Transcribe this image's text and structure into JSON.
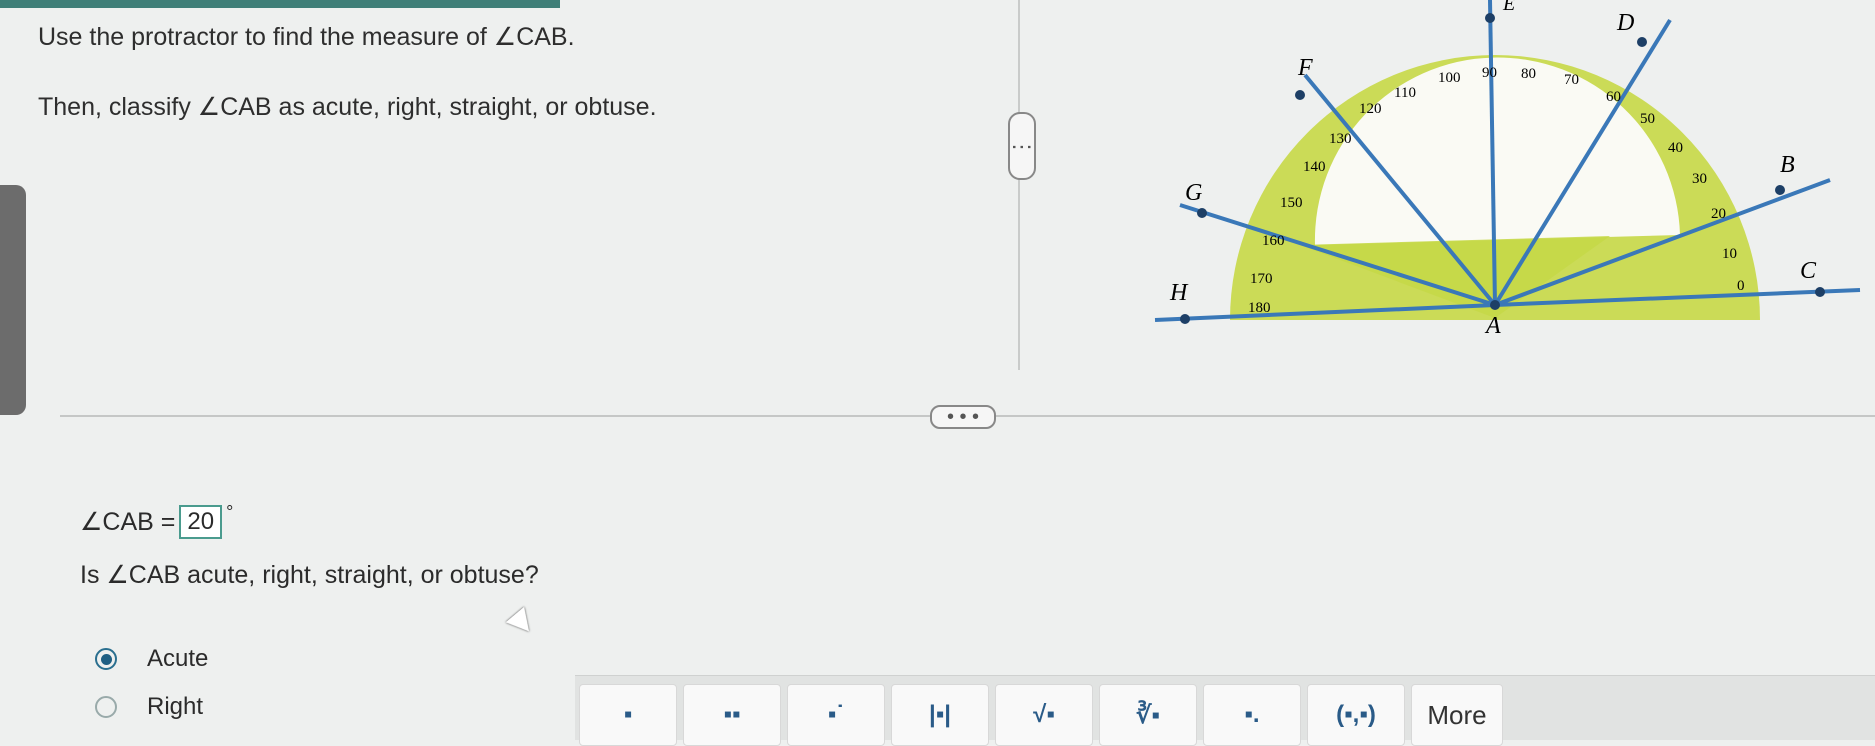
{
  "instructions": {
    "line1": "Use the protractor to find the measure of ∠CAB.",
    "line2": "Then, classify ∠CAB as acute, right, straight, or obtuse."
  },
  "answer": {
    "label": "∠CAB =",
    "value": "20",
    "unit": "°"
  },
  "question2": "Is ∠CAB acute, right, straight, or obtuse?",
  "options": [
    {
      "label": "Acute",
      "selected": true
    },
    {
      "label": "Right",
      "selected": false
    }
  ],
  "protractor": {
    "ticks": [
      "0",
      "10",
      "20",
      "30",
      "40",
      "50",
      "60",
      "70",
      "80",
      "90",
      "100",
      "110",
      "120",
      "130",
      "140",
      "150",
      "160",
      "170",
      "180"
    ],
    "points": {
      "A": "A",
      "B": "B",
      "C": "C",
      "D": "D",
      "E": "E",
      "F": "F",
      "G": "G",
      "H": "H"
    }
  },
  "toolbar": {
    "tools": [
      "square-icon",
      "superscript-icon",
      "subscript-icon",
      "absolute-value-icon",
      "sqrt-icon",
      "cube-root-icon",
      "decimal-icon",
      "ordered-pair-icon"
    ],
    "more_label": "More"
  },
  "handles": {
    "horizontal": "• • •",
    "vertical": "⋮"
  },
  "colors": {
    "accent": "#3f7f78",
    "protractor": "#c9d94a",
    "rays": "#3a78b8"
  }
}
